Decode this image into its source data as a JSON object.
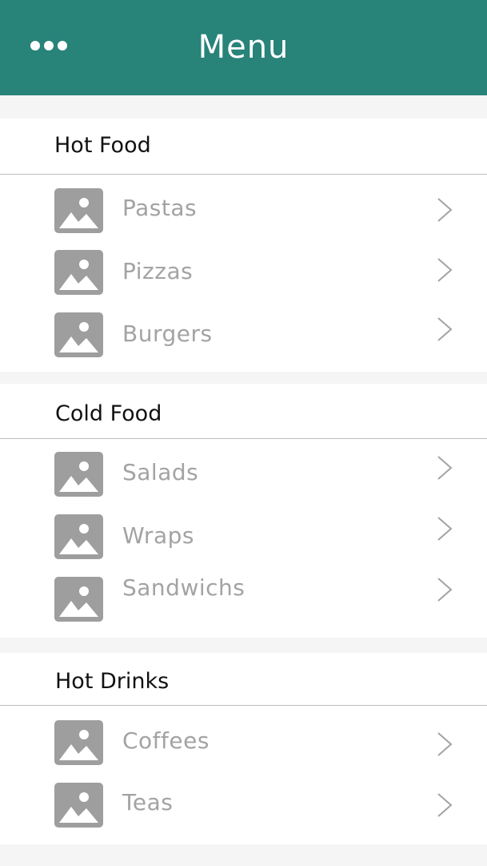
{
  "header": {
    "title": "Menu",
    "menu_icon": "more-dots-icon"
  },
  "colors": {
    "header_bg": "#288379",
    "label": "#a3a3a3",
    "thumb": "#9e9e9e"
  },
  "sections": [
    {
      "title": "Hot Food",
      "items": [
        {
          "label": "Pastas"
        },
        {
          "label": "Pizzas"
        },
        {
          "label": "Burgers"
        }
      ]
    },
    {
      "title": "Cold Food",
      "items": [
        {
          "label": "Salads"
        },
        {
          "label": "Wraps"
        },
        {
          "label": "Sandwichs"
        }
      ]
    },
    {
      "title": "Hot Drinks",
      "items": [
        {
          "label": "Coffees"
        },
        {
          "label": "Teas"
        }
      ]
    }
  ]
}
